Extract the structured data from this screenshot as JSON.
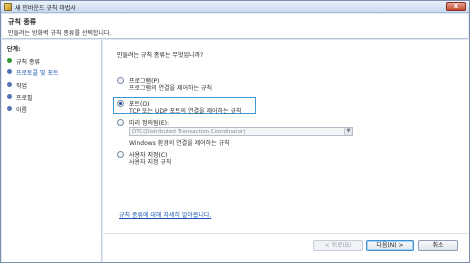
{
  "window": {
    "title": "새 인바운드 규칙 마법사",
    "close_glyph": "X"
  },
  "header": {
    "title": "규칙 종류",
    "description": "만들려는 방화벽 규칙 종류를 선택합니다."
  },
  "sidebar": {
    "steps_label": "단계:",
    "steps": [
      {
        "label": "규칙 종류",
        "state": "current"
      },
      {
        "label": "프로토콜 및 포트",
        "state": "link"
      },
      {
        "label": "작업",
        "state": "plain"
      },
      {
        "label": "프로필",
        "state": "plain"
      },
      {
        "label": "이름",
        "state": "plain"
      }
    ]
  },
  "main": {
    "question": "만들려는 규칙 종류는 무엇입니까?",
    "options": [
      {
        "title": "프로그램(P)",
        "desc": "프로그램의 연결을 제어하는 규칙",
        "checked": false
      },
      {
        "title": "포트(O)",
        "desc": "TCP 또는 UDP 포트의 연결을 제어하는 규칙",
        "checked": true
      },
      {
        "title": "미리 정의됨(E):",
        "desc": "Windows 환경의 연결을 제어하는 규칙",
        "checked": false
      },
      {
        "title": "사용자 지정(C)",
        "desc": "사용자 지정 규칙",
        "checked": false
      }
    ],
    "predefined_select_value": "DTC(Distributed Transaction Coordinator)",
    "learn_link": "규칙 종류에 대해 자세히 알아봅니다.",
    "buttons": {
      "back": "< 뒤로(B)",
      "next": "다음(N) >",
      "cancel": "취소"
    }
  },
  "colors": {
    "accent": "#3d9ad6",
    "link": "#1a55b0",
    "current_step": "#2f9a2f",
    "pending_step": "#5474b8"
  }
}
